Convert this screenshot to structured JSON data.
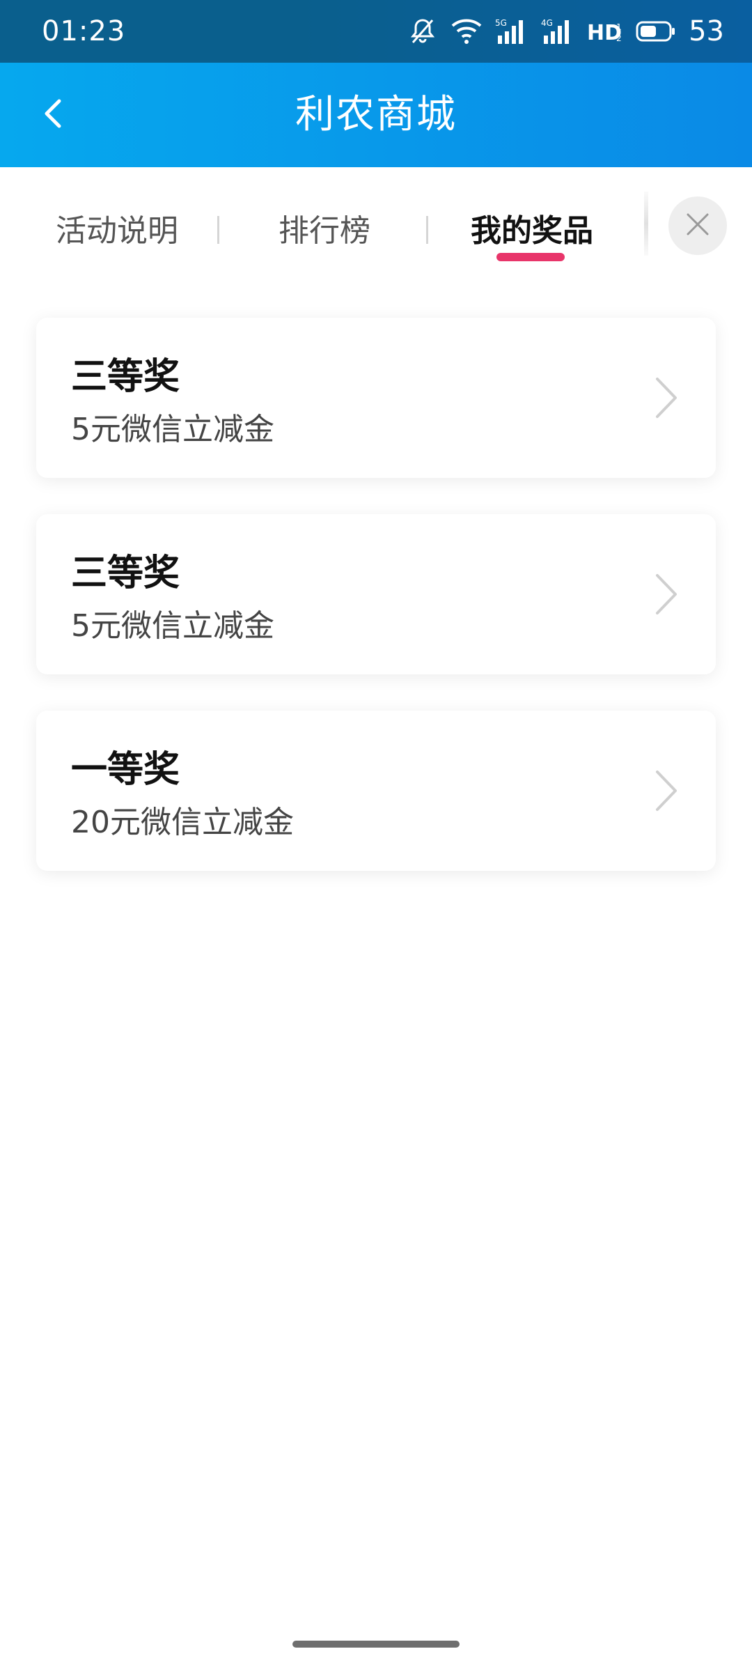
{
  "status_bar": {
    "time": "01:23",
    "battery": "53",
    "icons": [
      "mute-icon",
      "wifi-icon",
      "signal-5g-icon",
      "signal-4g-icon",
      "hd-icon",
      "battery-icon"
    ]
  },
  "app_bar": {
    "title": "利农商城",
    "back_icon": "chevron-left-icon"
  },
  "tabs": [
    {
      "label": "活动说明",
      "active": false
    },
    {
      "label": "排行榜",
      "active": false
    },
    {
      "label": "我的奖品",
      "active": true
    }
  ],
  "close_icon": "close-icon",
  "colors": {
    "accent": "#e8356a",
    "app_bar": "#0a8ae6",
    "status_bar": "#0a5f8d"
  },
  "prizes": [
    {
      "level": "三等奖",
      "desc": "5元微信立减金"
    },
    {
      "level": "三等奖",
      "desc": "5元微信立减金"
    },
    {
      "level": "一等奖",
      "desc": "20元微信立减金"
    }
  ]
}
